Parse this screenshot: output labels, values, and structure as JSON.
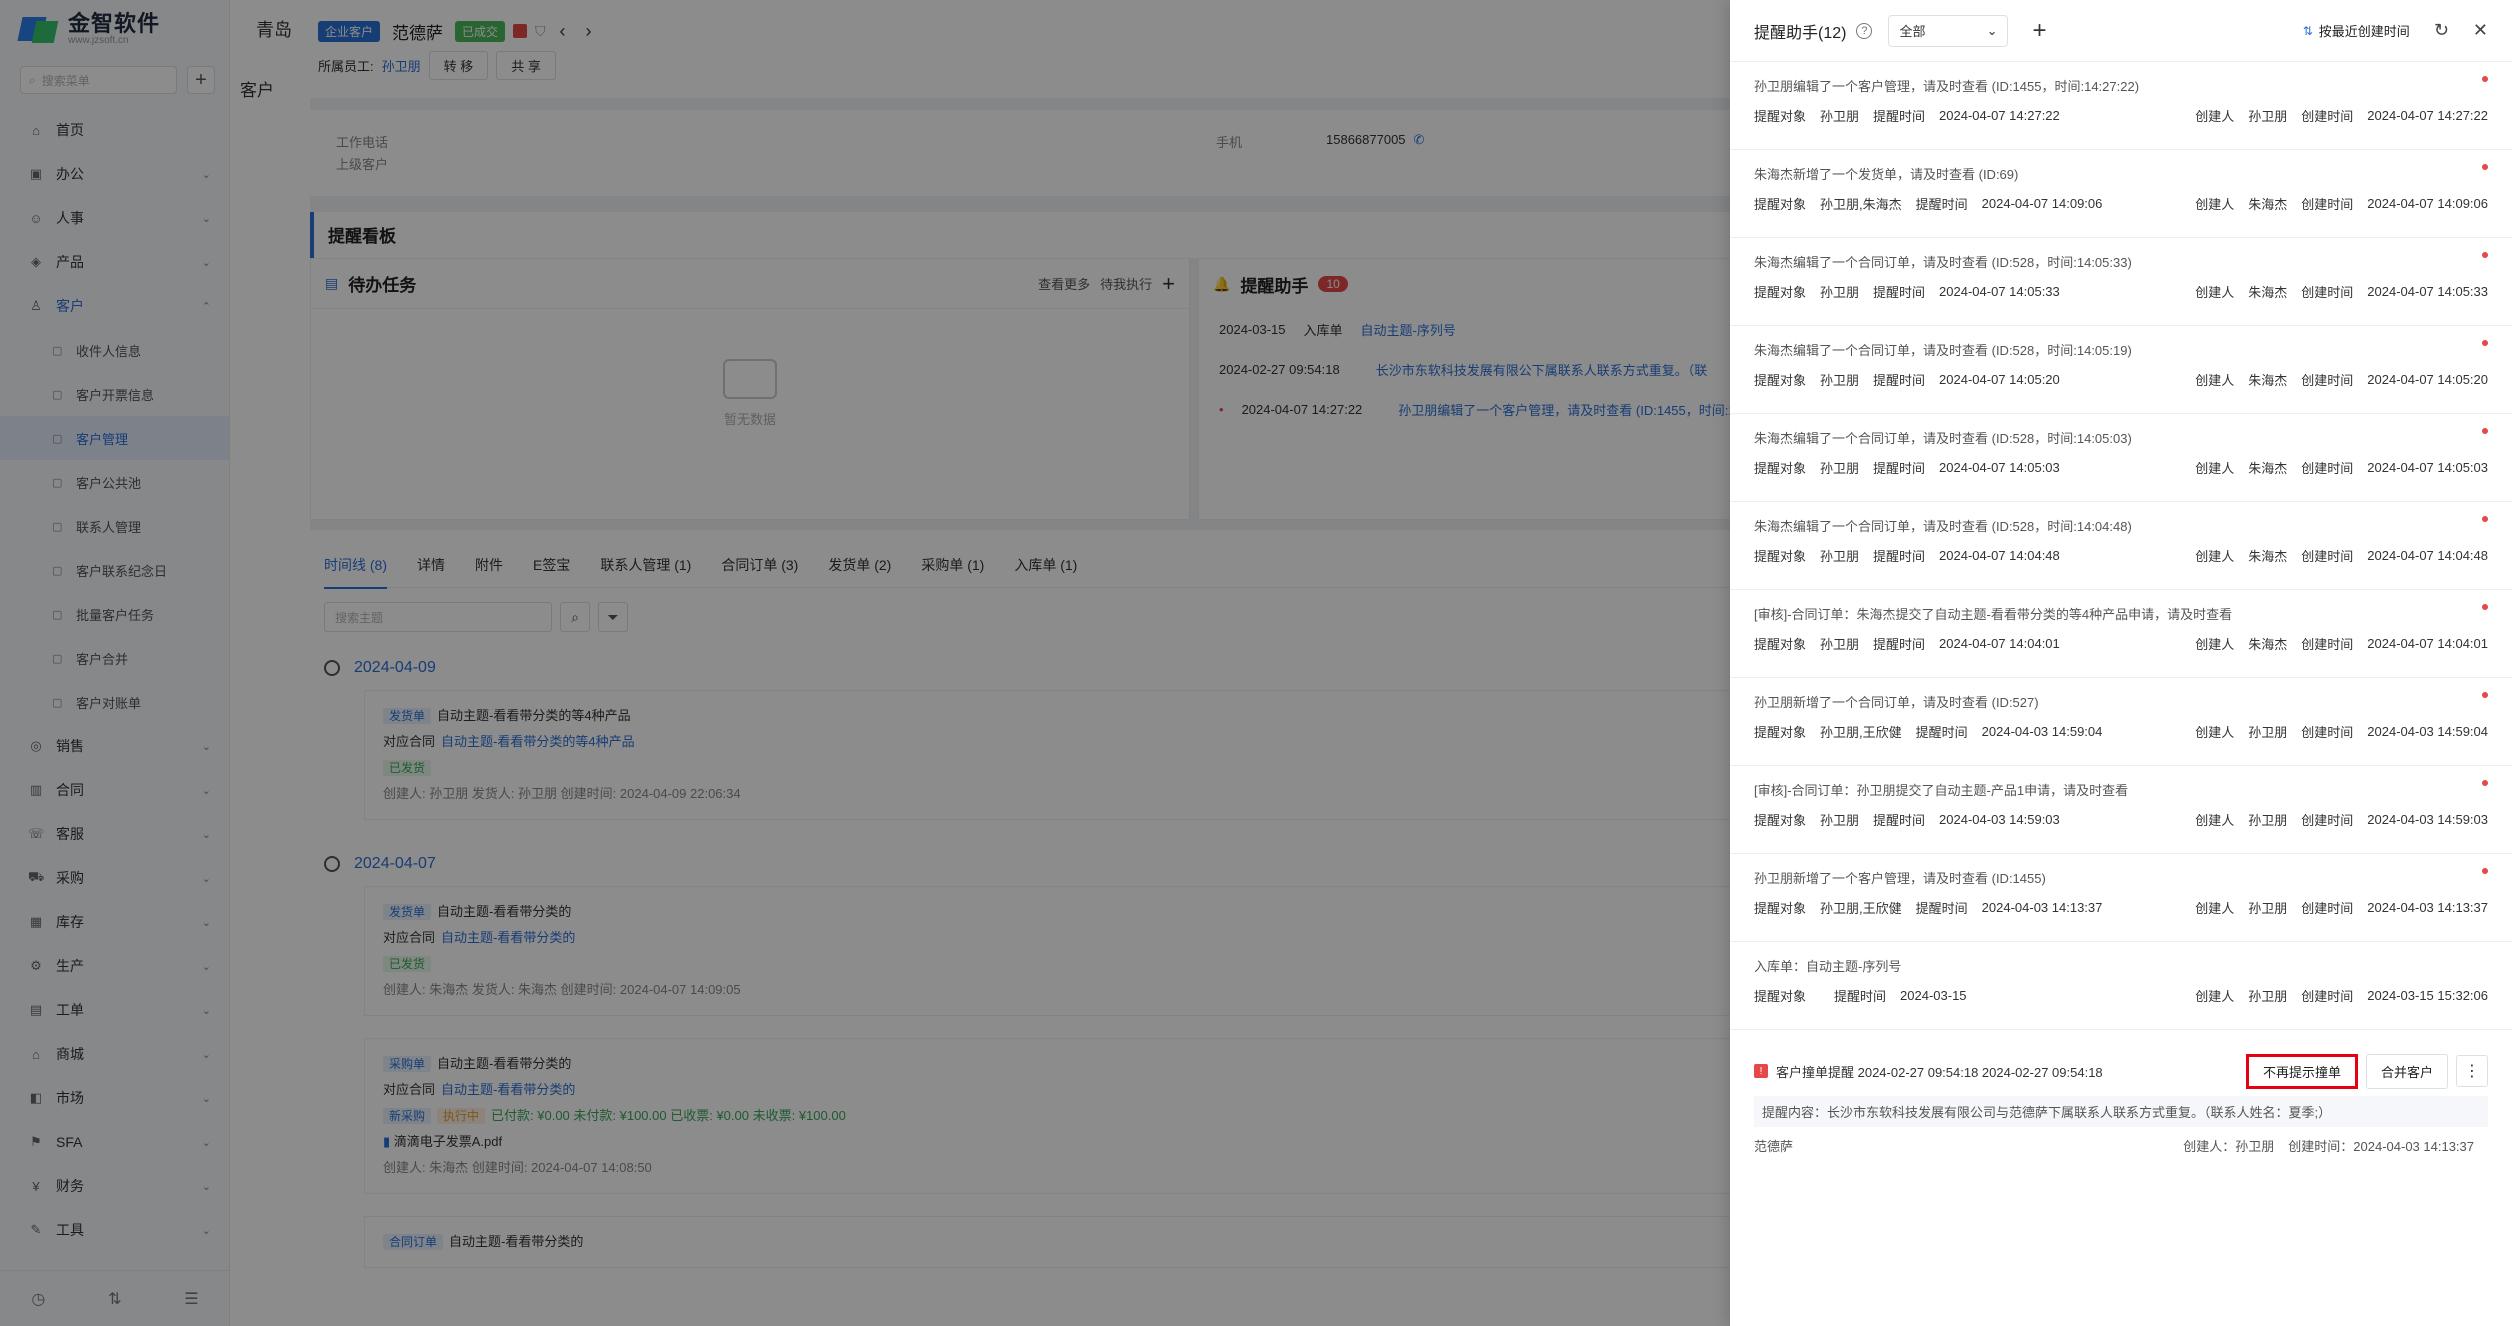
{
  "sidebar": {
    "logo_text": "金智软件",
    "logo_sub": "www.jzsoft.cn",
    "search_placeholder": "搜索菜单",
    "items": [
      {
        "label": "首页",
        "icon": "home-icon",
        "chev": ""
      },
      {
        "label": "办公",
        "icon": "office-icon",
        "chev": "⌄"
      },
      {
        "label": "人事",
        "icon": "hr-icon",
        "chev": "⌄"
      },
      {
        "label": "产品",
        "icon": "product-icon",
        "chev": "⌄"
      },
      {
        "label": "客户",
        "icon": "customer-icon",
        "chev": "⌃"
      }
    ],
    "sub_items": [
      "收件人信息",
      "客户开票信息",
      "客户管理",
      "客户公共池",
      "联系人管理",
      "客户联系纪念日",
      "批量客户任务",
      "客户合并",
      "客户对账单"
    ],
    "items_after": [
      {
        "label": "销售",
        "icon": "sales-icon"
      },
      {
        "label": "合同",
        "icon": "contract-icon"
      },
      {
        "label": "客服",
        "icon": "service-icon"
      },
      {
        "label": "采购",
        "icon": "purchase-icon"
      },
      {
        "label": "库存",
        "icon": "stock-icon"
      },
      {
        "label": "生产",
        "icon": "production-icon"
      },
      {
        "label": "工单",
        "icon": "workorder-icon"
      },
      {
        "label": "商城",
        "icon": "mall-icon"
      },
      {
        "label": "市场",
        "icon": "market-icon"
      },
      {
        "label": "SFA",
        "icon": "sfa-icon"
      },
      {
        "label": "财务",
        "icon": "finance-icon"
      },
      {
        "label": "工具",
        "icon": "tools-icon"
      }
    ]
  },
  "main": {
    "tab_title": "青岛",
    "left_title": "客户",
    "header": {
      "tag1": "企业客户",
      "name": "范德萨",
      "tag2": "已成交",
      "owner_label": "所属员工:",
      "owner": "孙卫朋",
      "transfer": "转 移",
      "share": "共 享"
    },
    "info": {
      "work_phone": "工作电话",
      "parent": "上级客户",
      "mobile_label": "手机",
      "mobile": "15866877005"
    },
    "board_title": "提醒看板",
    "todo": {
      "title": "待办任务",
      "more": "查看更多",
      "filter": "待我执行",
      "empty": "暂无数据"
    },
    "remind": {
      "title": "提醒助手",
      "count": "10",
      "rows": [
        {
          "date": "2024-03-15",
          "type": "入库单",
          "text": "自动主题-序列号"
        },
        {
          "date": "2024-02-27 09:54:18",
          "type": "",
          "text": "长沙市东软科技发展有限公下属联系人联系方式重复。（联"
        },
        {
          "date": "2024-04-07 14:27:22",
          "type": "",
          "text": "孙卫朋编辑了一个客户管理，请及时查看 (ID:1455，时间:14"
        }
      ]
    },
    "tl_tabs": [
      "时间线 (8)",
      "详情",
      "附件",
      "E签宝",
      "联系人管理 (1)",
      "合同订单 (3)",
      "发货单 (2)",
      "采购单 (1)",
      "入库单 (1)"
    ],
    "tl_search": "搜索主题",
    "timeline": [
      {
        "date": "2024-04-09",
        "items": [
          {
            "chip": "发货单",
            "title": "自动主题-看看带分类的等4种产品",
            "rel_label": "对应合同",
            "rel": "自动主题-看看带分类的等4种产品",
            "status": "已发货",
            "meta": "创建人: 孙卫朋    发货人: 孙卫朋    创建时间: 2024-04-09 22:06:34"
          }
        ]
      },
      {
        "date": "2024-04-07",
        "items": [
          {
            "chip": "发货单",
            "title": "自动主题-看看带分类的",
            "rel_label": "对应合同",
            "rel": "自动主题-看看带分类的",
            "status": "已发货",
            "meta": "创建人: 朱海杰    发货人: 朱海杰    创建时间: 2024-04-07 14:09:05"
          },
          {
            "chip": "采购单",
            "title": "自动主题-看看带分类的",
            "rel_label": "对应合同",
            "rel": "自动主题-看看带分类的",
            "status": "新采购",
            "status2": "执行中",
            "money": "已付款: ¥0.00   未付款: ¥100.00   已收票: ¥0.00   未收票: ¥100.00",
            "file": "滴滴电子发票A.pdf",
            "meta": "创建人: 朱海杰    创建时间: 2024-04-07 14:08:50"
          }
        ]
      }
    ],
    "last_chip": "合同订单",
    "last_title": "自动主题-看看带分类的"
  },
  "drawer": {
    "title": "提醒助手(12)",
    "filter": "全部",
    "sort": "按最近创建时间",
    "items": [
      {
        "title": "孙卫朋编辑了一个客户管理，请及时查看 (ID:1455，时间:14:27:22)",
        "target": "孙卫朋",
        "time": "2024-04-07 14:27:22",
        "creator": "孙卫朋",
        "ctime": "2024-04-07 14:27:22",
        "unread": true
      },
      {
        "title": "朱海杰新增了一个发货单，请及时查看 (ID:69)",
        "target": "孙卫朋,朱海杰",
        "time": "2024-04-07 14:09:06",
        "creator": "朱海杰",
        "ctime": "2024-04-07 14:09:06",
        "unread": true
      },
      {
        "title": "朱海杰编辑了一个合同订单，请及时查看 (ID:528，时间:14:05:33)",
        "target": "孙卫朋",
        "time": "2024-04-07 14:05:33",
        "creator": "朱海杰",
        "ctime": "2024-04-07 14:05:33",
        "unread": true
      },
      {
        "title": "朱海杰编辑了一个合同订单，请及时查看 (ID:528，时间:14:05:19)",
        "target": "孙卫朋",
        "time": "2024-04-07 14:05:20",
        "creator": "朱海杰",
        "ctime": "2024-04-07 14:05:20",
        "unread": true
      },
      {
        "title": "朱海杰编辑了一个合同订单，请及时查看 (ID:528，时间:14:05:03)",
        "target": "孙卫朋",
        "time": "2024-04-07 14:05:03",
        "creator": "朱海杰",
        "ctime": "2024-04-07 14:05:03",
        "unread": true
      },
      {
        "title": "朱海杰编辑了一个合同订单，请及时查看 (ID:528，时间:14:04:48)",
        "target": "孙卫朋",
        "time": "2024-04-07 14:04:48",
        "creator": "朱海杰",
        "ctime": "2024-04-07 14:04:48",
        "unread": true
      },
      {
        "title": "[审核]-合同订单：朱海杰提交了自动主题-看看带分类的等4种产品申请，请及时查看",
        "target": "孙卫朋",
        "time": "2024-04-07 14:04:01",
        "creator": "朱海杰",
        "ctime": "2024-04-07 14:04:01",
        "unread": true
      },
      {
        "title": "孙卫朋新增了一个合同订单，请及时查看 (ID:527)",
        "target": "孙卫朋,王欣健",
        "time": "2024-04-03 14:59:04",
        "creator": "孙卫朋",
        "ctime": "2024-04-03 14:59:04",
        "unread": true
      },
      {
        "title": "[审核]-合同订单：孙卫朋提交了自动主题-产品1申请，请及时查看",
        "target": "孙卫朋",
        "time": "2024-04-03 14:59:03",
        "creator": "孙卫朋",
        "ctime": "2024-04-03 14:59:03",
        "unread": true
      },
      {
        "title": "孙卫朋新增了一个客户管理，请及时查看 (ID:1455)",
        "target": "孙卫朋,王欣健",
        "time": "2024-04-03 14:13:37",
        "creator": "孙卫朋",
        "ctime": "2024-04-03 14:13:37",
        "unread": true
      },
      {
        "title": "入库单：自动主题-序列号",
        "target": "",
        "time": "2024-03-15",
        "creator": "孙卫朋",
        "ctime": "2024-03-15 15:32:06",
        "unread": false
      }
    ],
    "labels": {
      "target": "提醒对象",
      "time": "提醒时间",
      "creator": "创建人",
      "ctime": "创建时间"
    },
    "dup": {
      "title": "客户撞单提醒 2024-02-27 09:54:18  2024-02-27 09:54:18",
      "btn_stop": "不再提示撞单",
      "btn_merge": "合并客户",
      "content": "提醒内容：长沙市东软科技发展有限公司与范德萨下属联系人联系方式重复。（联系人姓名：夏季;）",
      "customer": "范德萨",
      "creator": "创建人：孙卫朋",
      "ctime": "创建时间：2024-04-03 14:13:37"
    }
  }
}
